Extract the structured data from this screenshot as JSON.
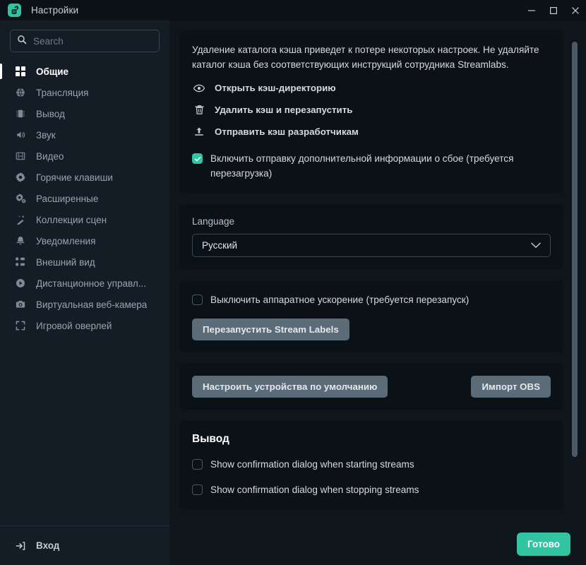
{
  "window": {
    "title": "Настройки",
    "logo_icon": "streamlabs-logo-icon",
    "minimize_icon": "minimize-icon",
    "maximize_icon": "maximize-icon",
    "close_icon": "close-icon",
    "accent_color": "#31c3a2",
    "titlebar_bg": "#0b1116",
    "sidebar_bg": "#141d26",
    "content_bg": "#0e151b",
    "panel_bg": "#0b1217"
  },
  "search": {
    "placeholder": "Search",
    "value": "",
    "icon": "search-icon"
  },
  "sidebar": {
    "items": [
      {
        "label": "Общие",
        "icon": "grid-icon",
        "active": true
      },
      {
        "label": "Трансляция",
        "icon": "globe-icon",
        "active": false
      },
      {
        "label": "Вывод",
        "icon": "chip-icon",
        "active": false
      },
      {
        "label": "Звук",
        "icon": "speaker-icon",
        "active": false
      },
      {
        "label": "Видео",
        "icon": "film-icon",
        "active": false
      },
      {
        "label": "Горячие клавиши",
        "icon": "gear-icon",
        "active": false
      },
      {
        "label": "Расширенные",
        "icon": "gears-icon",
        "active": false
      },
      {
        "label": "Коллекции сцен",
        "icon": "wand-icon",
        "active": false
      },
      {
        "label": "Уведомления",
        "icon": "bell-icon",
        "active": false
      },
      {
        "label": "Внешний вид",
        "icon": "layout-icon",
        "active": false
      },
      {
        "label": "Дистанционное управл...",
        "icon": "play-circle-icon",
        "active": false
      },
      {
        "label": "Виртуальная веб-камера",
        "icon": "camera-icon",
        "active": false
      },
      {
        "label": "Игровой оверлей",
        "icon": "expand-icon",
        "active": false
      }
    ],
    "footer": {
      "label": "Вход",
      "icon": "login-icon"
    }
  },
  "content": {
    "cache_panel": {
      "intro": "Удаление каталога кэша приведет к потере некоторых настроек. Не удаляйте каталог кэша без соответствующих инструкций сотрудника Streamlabs.",
      "actions": [
        {
          "label": "Открыть кэш-директорию",
          "icon": "eye-icon"
        },
        {
          "label": "Удалить кэш и перезапустить",
          "icon": "trash-icon"
        },
        {
          "label": "Отправить кэш разработчикам",
          "icon": "upload-icon"
        }
      ],
      "checkbox": {
        "label": "Включить отправку дополнительной информации о сбое (требуется перезагрузка)",
        "checked": true
      }
    },
    "language_panel": {
      "label": "Language",
      "selected": "Русский",
      "chevron_icon": "chevron-down-icon"
    },
    "hardware_panel": {
      "checkbox": {
        "label": "Выключить аппаратное ускорение (требуется перезапуск)",
        "checked": false
      },
      "button": "Перезапустить Stream Labels"
    },
    "devices_panel": {
      "left_button": "Настроить устройства по умолчанию",
      "right_button": "Импорт OBS"
    },
    "output_panel": {
      "title": "Вывод",
      "checkboxes": [
        {
          "label": "Show confirmation dialog when starting streams",
          "checked": false
        },
        {
          "label": "Show confirmation dialog when stopping streams",
          "checked": false
        }
      ]
    }
  },
  "footer": {
    "done_label": "Готово"
  }
}
